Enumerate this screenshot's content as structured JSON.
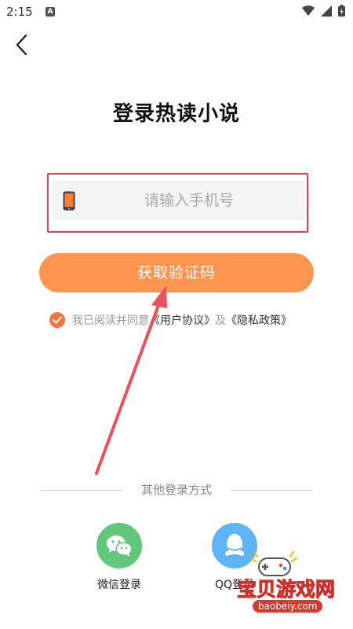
{
  "status_bar": {
    "time": "2:15",
    "app_indicator": "A",
    "icons": [
      "wifi-icon",
      "signal-icon",
      "battery-icon"
    ]
  },
  "header": {
    "back_icon": "chevron-left-icon",
    "title": "登录热读小说"
  },
  "login": {
    "phone_placeholder": "请输入手机号",
    "phone_value": "",
    "get_code_label": "获取验证码",
    "agreement": {
      "checked": true,
      "prefix": "我已阅读并同意",
      "user_agreement": "《用户协议》",
      "and": "及",
      "privacy_policy": "《隐私政策》"
    }
  },
  "other_login": {
    "title": "其他登录方式",
    "options": [
      {
        "label": "微信登录",
        "icon": "wechat-icon"
      },
      {
        "label": "QQ登录",
        "icon": "qq-icon"
      }
    ]
  },
  "watermark": {
    "text": "宝贝游戏网",
    "url": "baobeiy.com"
  },
  "colors": {
    "accent": "#fe9550",
    "checkbox": "#f5733c",
    "highlight": "#e2424f",
    "wechat": "#62c77a",
    "qq": "#5fb4f7"
  }
}
